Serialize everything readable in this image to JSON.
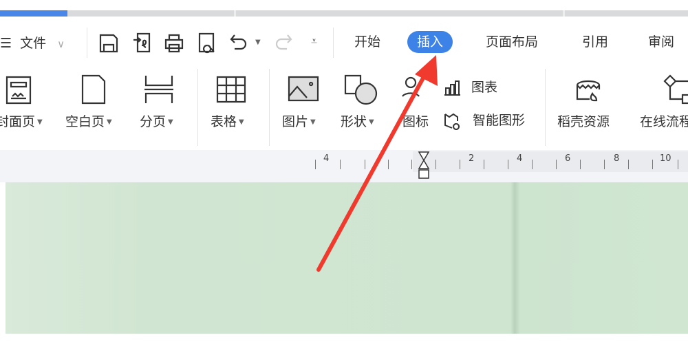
{
  "menu": {
    "file_label": "文件",
    "tabs": [
      {
        "label": "开始"
      },
      {
        "label": "插入",
        "active": true
      },
      {
        "label": "页面布局"
      },
      {
        "label": "引用"
      },
      {
        "label": "审阅"
      }
    ]
  },
  "quick_access": [
    "save-icon",
    "export-pdf-icon",
    "print-icon",
    "print-preview-icon",
    "undo-icon",
    "redo-icon",
    "customize-icon"
  ],
  "ribbon": {
    "cover_page": "封面页",
    "blank_page": "空白页",
    "page_break": "分页",
    "table": "表格",
    "picture": "图片",
    "shape": "形状",
    "icon": "图标",
    "chart": "图表",
    "smart_art": "智能图形",
    "docer_resources": "稻壳资源",
    "online_flowchart": "在线流程图"
  },
  "ruler": {
    "labels": [
      "4",
      "2",
      "4",
      "6",
      "8",
      "10"
    ]
  },
  "colors": {
    "accent": "#3d82e6",
    "annotation_arrow": "#f03a2e",
    "document_bg": "#d0e6d1"
  }
}
